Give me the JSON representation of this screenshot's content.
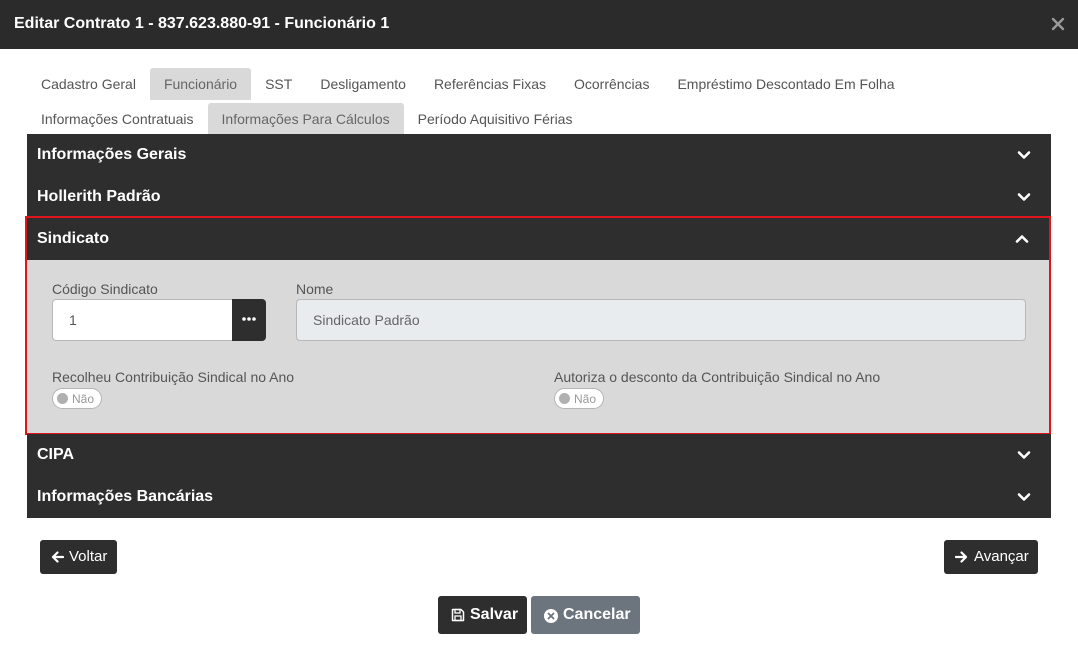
{
  "modal": {
    "title": "Editar Contrato 1 - 837.623.880-91 - Funcionário 1"
  },
  "tabs": {
    "row1": [
      "Cadastro Geral",
      "Funcionário",
      "SST",
      "Desligamento",
      "Referências Fixas",
      "Ocorrências",
      "Empréstimo Descontado Em Folha"
    ],
    "row2": [
      "Informações Contratuais",
      "Informações Para Cálculos",
      "Período Aquisitivo Férias"
    ],
    "active": [
      "Funcionário",
      "Informações Para Cálculos"
    ]
  },
  "sections": {
    "informacoes_gerais": "Informações Gerais",
    "hollerith": "Hollerith Padrão",
    "sindicato": "Sindicato",
    "cipa": "CIPA",
    "bancarias": "Informações Bancárias"
  },
  "sindicato": {
    "codigo_label": "Código Sindicato",
    "codigo_value": "1",
    "nome_label": "Nome",
    "nome_value": "Sindicato Padrão",
    "recolheu_label": "Recolheu Contribuição Sindical no Ano",
    "recolheu_value": "Não",
    "autoriza_label": "Autoriza o desconto da Contribuição Sindical no Ano",
    "autoriza_value": "Não"
  },
  "navigation": {
    "back_label": "Voltar",
    "next_label": "Avançar"
  },
  "footer": {
    "save_label": "Salvar",
    "cancel_label": "Cancelar"
  },
  "colors": {
    "header_bg": "#2b2b2b",
    "section_bg": "#2e2e2e",
    "panel_bg": "#d9d9d9",
    "highlight_border": "#e0141b",
    "cancel_bg": "#6c757d"
  },
  "icons": {
    "close": "close-icon",
    "expand": "chevron-down-icon",
    "collapse": "chevron-up-icon",
    "lookup": "ellipsis-icon",
    "back": "arrow-left-icon",
    "next": "arrow-right-icon",
    "save": "floppy-disk-icon",
    "cancel": "circle-x-icon"
  }
}
